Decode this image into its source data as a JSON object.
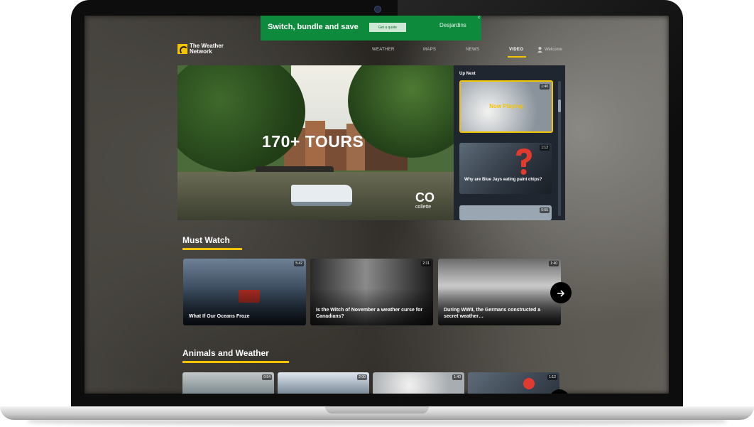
{
  "ad": {
    "headline": "Switch, bundle and save",
    "button_label": "Get a quote",
    "sponsor": "Desjardins",
    "close_label": "x"
  },
  "header": {
    "logo_text": "The Weather Network",
    "nav": [
      {
        "label": "WEATHER"
      },
      {
        "label": "MAPS"
      },
      {
        "label": "NEWS"
      },
      {
        "label": "VIDEO"
      }
    ],
    "welcome": "Welcome"
  },
  "hero": {
    "overlay_text": "170+ TOURS",
    "brand_mark": "CO",
    "brand_name": "collette"
  },
  "up_next": {
    "title": "Up Next",
    "items": [
      {
        "duration": "1:40",
        "status": "Now Playing",
        "caption": ""
      },
      {
        "duration": "1:12",
        "status": "",
        "caption": "Why are Blue Jays eating paint chips?"
      },
      {
        "duration": "0:55",
        "status": "",
        "caption": ""
      }
    ]
  },
  "must_watch": {
    "title": "Must Watch",
    "cards": [
      {
        "duration": "5:42",
        "title": "What If Our Oceans Froze"
      },
      {
        "duration": "2:31",
        "title": "Is the Witch of November a weather curse for Canadians?"
      },
      {
        "duration": "1:40",
        "title": "During WWII, the Germans constructed a secret weather…"
      }
    ]
  },
  "animals_weather": {
    "title": "Animals and Weather",
    "cards": [
      {
        "duration": "0:54"
      },
      {
        "duration": "2:00"
      },
      {
        "duration": "1:40"
      },
      {
        "duration": "1:12"
      }
    ]
  },
  "colors": {
    "accent": "#f5c400",
    "ad_green": "#0e8a3d",
    "panel": "#1f2630"
  }
}
